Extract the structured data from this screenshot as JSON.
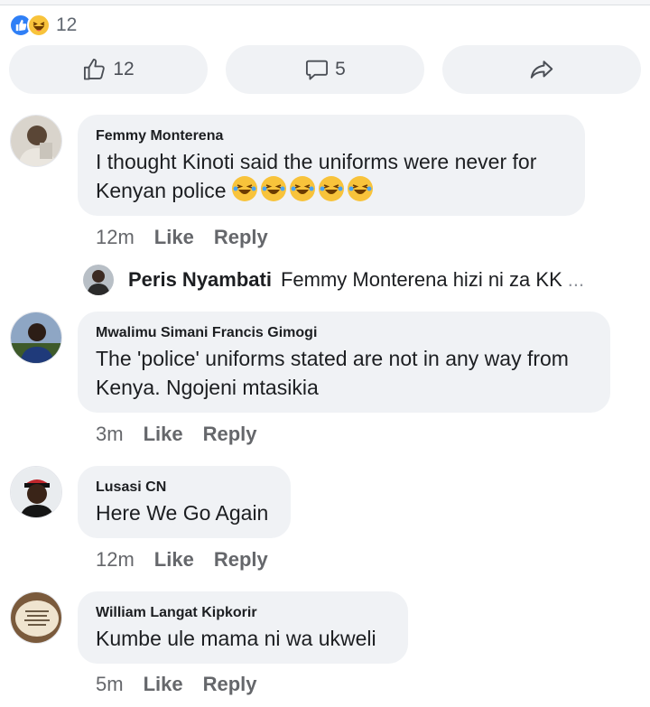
{
  "reactions": {
    "count": "12",
    "icons": [
      "like-icon",
      "haha-icon"
    ],
    "colors": {
      "like": "#2f7ff6",
      "haha": "#f8c33b"
    }
  },
  "actions": {
    "like_count": "12",
    "comment_count": "5"
  },
  "comments": [
    {
      "author": "Femmy Monterena",
      "text": "I thought Kinoti said the uniforms were never for Kenyan police",
      "emoji": [
        "rofl",
        "rofl",
        "rofl",
        "rofl",
        "rofl"
      ],
      "time": "12m",
      "like": "Like",
      "reply": "Reply"
    },
    {
      "author": "Mwalimu Simani Francis Gimogi",
      "text": "The 'police' uniforms stated are not in any way from Kenya. Ngojeni mtasikia",
      "time": "3m",
      "like": "Like",
      "reply": "Reply"
    },
    {
      "author": "Lusasi CN",
      "text": "Here We Go Again",
      "time": "12m",
      "like": "Like",
      "reply": "Reply"
    },
    {
      "author": "William Langat Kipkorir",
      "text": "Kumbe ule mama ni wa ukweli",
      "time": "5m",
      "like": "Like",
      "reply": "Reply"
    }
  ],
  "reply_preview": {
    "author": "Peris Nyambati",
    "text": "Femmy Monterena hizi ni za KK",
    "more": "..."
  }
}
